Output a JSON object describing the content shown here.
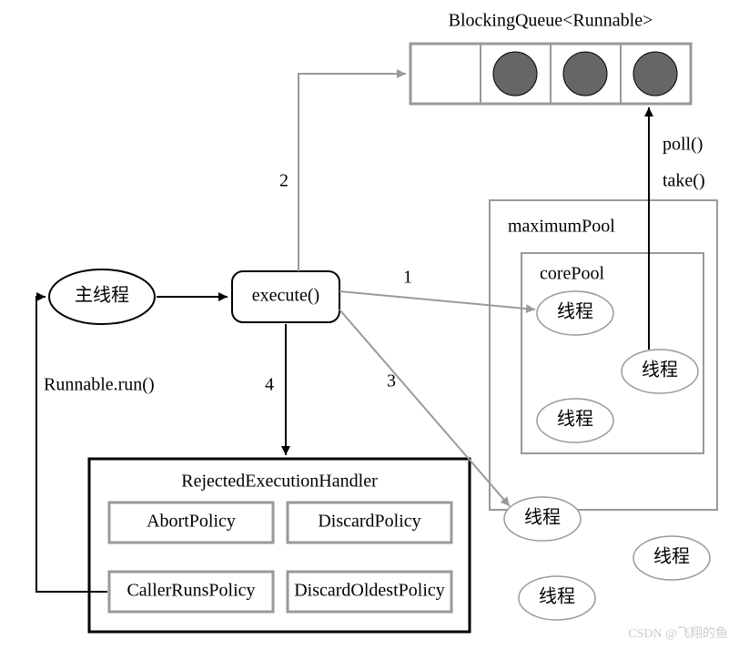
{
  "title": "BlockingQueue<Runnable>",
  "mainThread": "主线程",
  "execute": "execute()",
  "runnableRun": "Runnable.run()",
  "poll": "poll()",
  "take": "take()",
  "maximumPool": "maximumPool",
  "corePool": "corePool",
  "thread": "线程",
  "handler": {
    "title": "RejectedExecutionHandler",
    "abort": "AbortPolicy",
    "discard": "DiscardPolicy",
    "callerRuns": "CallerRunsPolicy",
    "discardOldest": "DiscardOldestPolicy"
  },
  "steps": {
    "s1": "1",
    "s2": "2",
    "s3": "3",
    "s4": "4"
  },
  "watermark": "CSDN @飞翔的鱼"
}
